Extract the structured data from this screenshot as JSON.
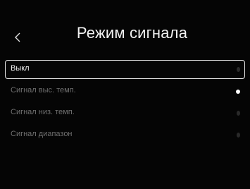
{
  "header": {
    "title": "Режим сигнала",
    "back_icon": "chevron-left-icon"
  },
  "options": [
    {
      "label": "Выкл",
      "highlighted": true,
      "checked": false
    },
    {
      "label": "Сигнал выс. темп.",
      "highlighted": false,
      "checked": true
    },
    {
      "label": "Сигнал низ. темп.",
      "highlighted": false,
      "checked": false
    },
    {
      "label": "Сигнал диапазон",
      "highlighted": false,
      "checked": false
    }
  ],
  "colors": {
    "background": "#050505",
    "title": "#f2f2f2",
    "highlight_border": "#e6e6e6",
    "inactive_text": "#6f6f6f",
    "radio_active": "#ffffff"
  }
}
